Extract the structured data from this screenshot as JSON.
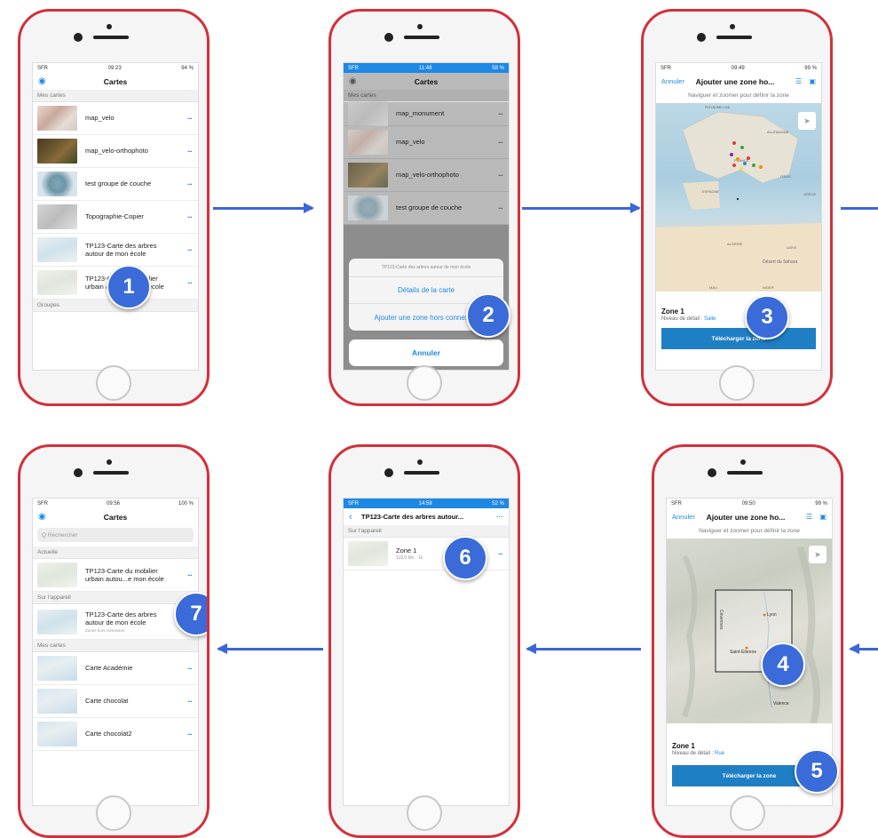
{
  "colors": {
    "accent": "#1e88e5",
    "badge": "#3a6bd8",
    "frame": "#d3303a",
    "arrow": "#3b66da"
  },
  "phone1": {
    "status": {
      "carrier": "SFR",
      "time": "09:23",
      "battery": "94 %"
    },
    "title": "Cartes",
    "section_my_maps": "Mes cartes",
    "section_groups": "Groupes",
    "items": [
      {
        "label": "map_velo",
        "more": "···"
      },
      {
        "label": "map_velo-orthophoto",
        "more": "···"
      },
      {
        "label": "test groupe de couche",
        "more": "···"
      },
      {
        "label": "Topographie-Copier",
        "more": "···"
      },
      {
        "label_line1": "TP123-Carte des arbres",
        "label_line2": "autour de mon école",
        "more": "···"
      },
      {
        "label_line1": "TP123-Carte du mobilier",
        "label_line2": "urbain autou...e mon école",
        "more": "···"
      }
    ],
    "badge": "1"
  },
  "phone2": {
    "status": {
      "carrier": "SFR",
      "time": "11:48",
      "battery": "58 %"
    },
    "title": "Cartes",
    "section_my_maps": "Mes cartes",
    "items": [
      {
        "label": "map_monument",
        "more": "···"
      },
      {
        "label": "map_velo",
        "more": "···"
      },
      {
        "label": "map_velo-orthophoto",
        "more": "···"
      },
      {
        "label": "test groupe de couche",
        "more": "···"
      }
    ],
    "sheet_header": "TP123-Carte des arbres autour de mon école",
    "opt_details": "Détails de la carte",
    "opt_offline": "Ajouter une zone hors connexion",
    "cancel": "Annuler",
    "badge": "2"
  },
  "phone3": {
    "status": {
      "carrier": "SFR",
      "time": "09:49",
      "battery": "99 %"
    },
    "cancel": "Annuler",
    "title": "Ajouter une zone ho...",
    "hint": "Naviguer et zoomer pour définir la zone",
    "map_labels": [
      "ROYAUME-UNI",
      "ALLEMAGNE",
      "FRANCE",
      "ITALIE",
      "ESPAGNE",
      "GRÈCE",
      "ALGÉRIE",
      "LIBYE",
      "Désert du Sahara",
      "MALI",
      "NIGER"
    ],
    "zone_title": "Zone 1",
    "detail_label": "Niveau de détail : ",
    "detail_value": "Salle",
    "download": "Télécharger la zone",
    "badge": "3"
  },
  "phone4": {
    "status": {
      "carrier": "SFR",
      "time": "09:56",
      "battery": "100 %"
    },
    "title": "Cartes",
    "search_placeholder": "Q  Rechercher",
    "section_current": "Actuelle",
    "current_line1": "TP123-Carte du mobilier",
    "current_line2": "urbain autou...e mon école",
    "section_device": "Sur l'appareil",
    "device_line1": "TP123-Carte des arbres",
    "device_line2": "autour de mon école",
    "device_sub": "Zones hors connexion",
    "section_my_maps": "Mes cartes",
    "items": [
      {
        "label": "Carte Académie",
        "more": "···"
      },
      {
        "label": "Carte chocolat",
        "more": "···"
      },
      {
        "label": "Carte chocolat2",
        "more": "···"
      }
    ],
    "badge": "7"
  },
  "phone5": {
    "status": {
      "carrier": "SFR",
      "time": "14:58",
      "battery": "52 %"
    },
    "title": "TP123-Carte des arbres autour...",
    "section_device": "Sur l'appareil",
    "zone_label": "Zone 1",
    "zone_meta": "118,6 Mo · 1k",
    "more": "···",
    "badge": "6"
  },
  "phone6": {
    "status": {
      "carrier": "SFR",
      "time": "09:50",
      "battery": "99 %"
    },
    "cancel": "Annuler",
    "title": "Ajouter une zone ho...",
    "hint": "Naviguer et zoomer pour définir la zone",
    "map_labels": [
      "Cévennes",
      "Lyon",
      "Saint-Étienne",
      "Valence"
    ],
    "zone_title": "Zone 1",
    "detail_label": "Niveau de détail : ",
    "detail_value": "Rue",
    "download": "Télécharger la zone",
    "badge_zone": "4",
    "badge_download": "5"
  }
}
